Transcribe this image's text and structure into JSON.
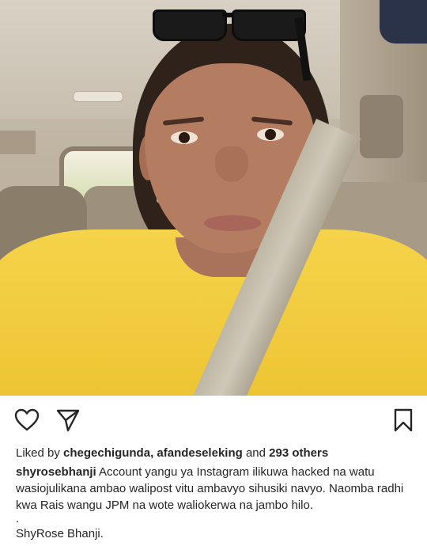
{
  "post": {
    "likes": {
      "prefix": "Liked by",
      "users": "chegechigunda, afandeseleking",
      "connector": "and",
      "others": "293 others"
    },
    "caption": {
      "username": "shyrosebhanji",
      "text": "Account yangu ya Instagram ilikuwa hacked na watu wasiojulikana ambao walipost vitu ambavyo sihusiki navyo. Naomba radhi kwa Rais wangu JPM na wote waliokerwa na jambo hilo.",
      "separator": ".",
      "signature": "ShyRose Bhanji."
    },
    "icons": {
      "like": "heart-icon",
      "share": "send-icon",
      "save": "bookmark-icon"
    }
  }
}
